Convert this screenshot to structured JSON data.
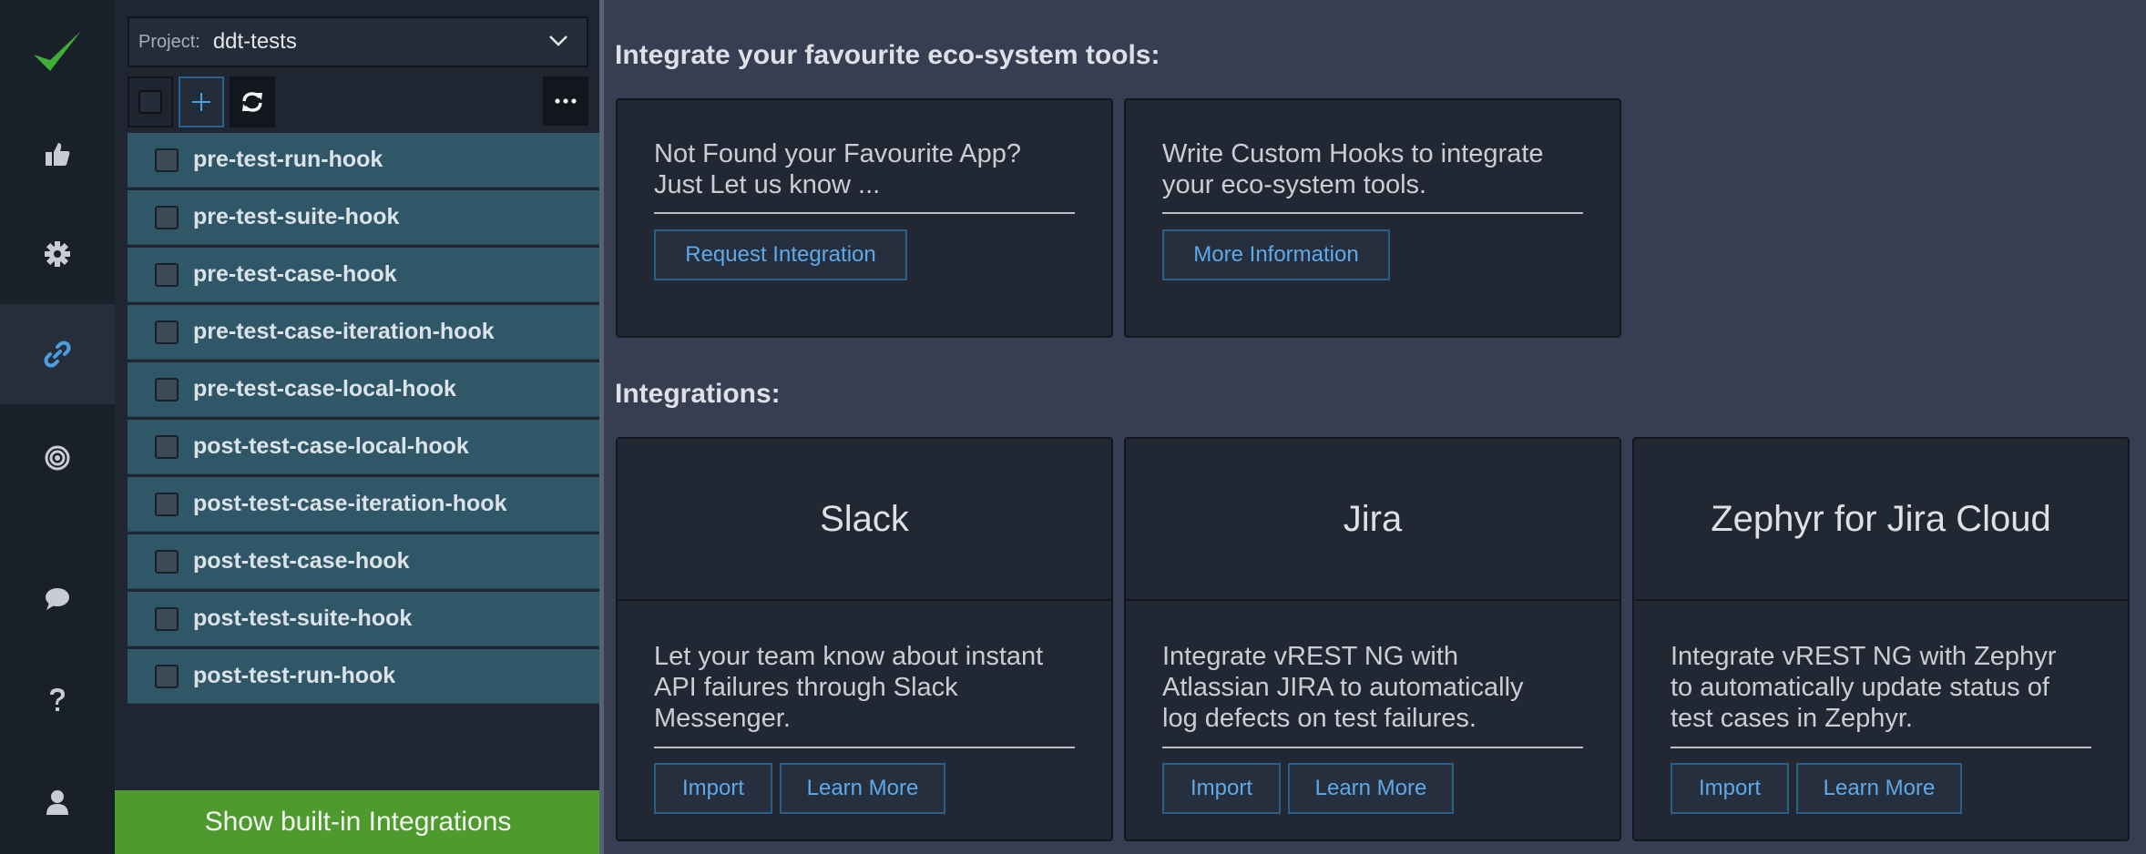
{
  "rail": {
    "items": [
      {
        "name": "check-logo-icon"
      },
      {
        "name": "thumbs-up-icon"
      },
      {
        "name": "gear-icon"
      },
      {
        "name": "link-icon",
        "active": true
      },
      {
        "name": "target-icon"
      },
      {
        "name": "chat-bubble-icon"
      },
      {
        "name": "question-icon"
      },
      {
        "name": "user-icon"
      }
    ],
    "accent": "#4b9fe1",
    "logo_color": "#3fae36"
  },
  "sidebar": {
    "project_label": "Project:",
    "project_value": "ddt-tests",
    "hooks": [
      {
        "label": "pre-test-run-hook"
      },
      {
        "label": "pre-test-suite-hook"
      },
      {
        "label": "pre-test-case-hook"
      },
      {
        "label": "pre-test-case-iteration-hook"
      },
      {
        "label": "pre-test-case-local-hook"
      },
      {
        "label": "post-test-case-local-hook"
      },
      {
        "label": "post-test-case-iteration-hook"
      },
      {
        "label": "post-test-case-hook"
      },
      {
        "label": "post-test-suite-hook"
      },
      {
        "label": "post-test-run-hook"
      }
    ],
    "show_builtin_label": "Show built-in Integrations",
    "show_builtin_color": "#4f9a2e"
  },
  "main": {
    "eco_title": "Integrate your favourite eco-system tools:",
    "eco_cards": [
      {
        "text_line1": "Not Found your Favourite App?",
        "text_line2": "Just Let us know ...",
        "button": "Request Integration"
      },
      {
        "text_line1": "Write Custom Hooks to integrate",
        "text_line2": "your eco-system tools.",
        "button": "More Information"
      }
    ],
    "integrations_title": "Integrations:",
    "integrations": [
      {
        "name": "Slack",
        "lines": [
          "Let your team know about instant",
          "API failures through Slack",
          "Messenger."
        ],
        "import": "Import",
        "learn_more": "Learn More"
      },
      {
        "name": "Jira",
        "lines": [
          "Integrate vREST NG with",
          "Atlassian JIRA to automatically",
          "log defects on test failures."
        ],
        "import": "Import",
        "learn_more": "Learn More"
      },
      {
        "name": "Zephyr for Jira Cloud",
        "lines": [
          "Integrate vREST NG with Zephyr",
          "to automatically update status of",
          "test cases in Zephyr."
        ],
        "import": "Import",
        "learn_more": "Learn More"
      }
    ]
  }
}
